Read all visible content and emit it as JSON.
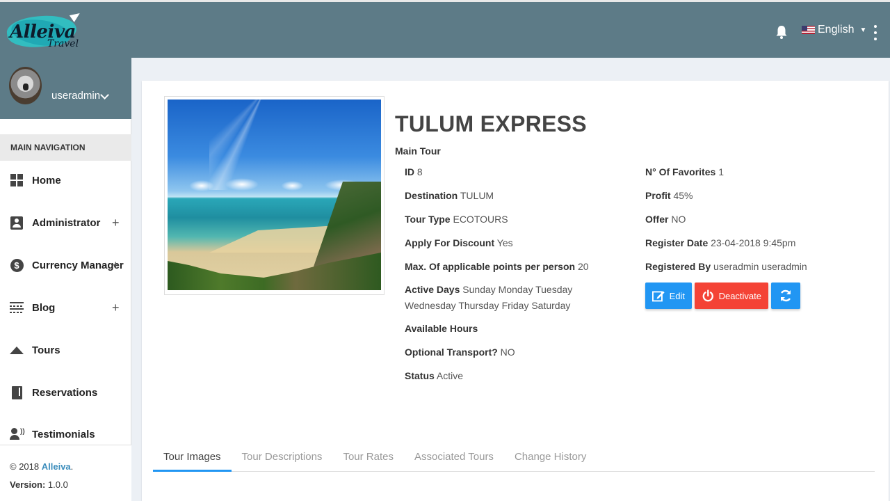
{
  "header": {
    "logo": {
      "name": "Alleiva",
      "sub": "Travel"
    },
    "language": "English"
  },
  "sidebar": {
    "username": "useradmin",
    "nav_header": "MAIN NAVIGATION",
    "items": [
      {
        "label": "Home",
        "icon": "home-icon"
      },
      {
        "label": "Administrator",
        "icon": "admin-icon",
        "expand": "+"
      },
      {
        "label": "Currency Manager",
        "icon": "currency-icon",
        "expand": "+"
      },
      {
        "label": "Blog",
        "icon": "blog-icon",
        "expand": "+"
      },
      {
        "label": "Tours",
        "icon": "tours-icon"
      },
      {
        "label": "Reservations",
        "icon": "reservations-icon"
      },
      {
        "label": "Testimonials",
        "icon": "testimonials-icon"
      }
    ],
    "footer": {
      "copyright": "© 2018",
      "brand": "Alleiva",
      "dot": ".",
      "version_label": "Version:",
      "version": "1.0.0"
    }
  },
  "tour": {
    "title": "TULUM EXPRESS",
    "subtitle": "Main Tour",
    "left": [
      {
        "label": "ID",
        "value": "8"
      },
      {
        "label": "Destination",
        "value": "TULUM"
      },
      {
        "label": "Tour Type",
        "value": "ECOTOURS"
      },
      {
        "label": "Apply For Discount",
        "value": "Yes"
      },
      {
        "label": "Max. Of applicable points per person",
        "value": "20"
      },
      {
        "label": "Active Days",
        "value": "Sunday Monday Tuesday Wednesday Thursday Friday Saturday"
      },
      {
        "label": "Available Hours",
        "value": ""
      },
      {
        "label": "Optional Transport?",
        "value": "NO"
      },
      {
        "label": "Status",
        "value": "Active"
      }
    ],
    "right": [
      {
        "label": "N° Of Favorites",
        "value": "1"
      },
      {
        "label": "Profit",
        "value": "45%"
      },
      {
        "label": "Offer",
        "value": "NO"
      },
      {
        "label": "Register Date",
        "value": "23-04-2018 9:45pm"
      },
      {
        "label": "Registered By",
        "value": "useradmin useradmin"
      }
    ],
    "buttons": {
      "edit": "Edit",
      "deactivate": "Deactivate"
    }
  },
  "tabs": [
    "Tour Images",
    "Tour Descriptions",
    "Tour Rates",
    "Associated Tours",
    "Change History"
  ],
  "colors": {
    "header": "#5d7b87",
    "primary": "#2196f3",
    "danger": "#f44336"
  }
}
